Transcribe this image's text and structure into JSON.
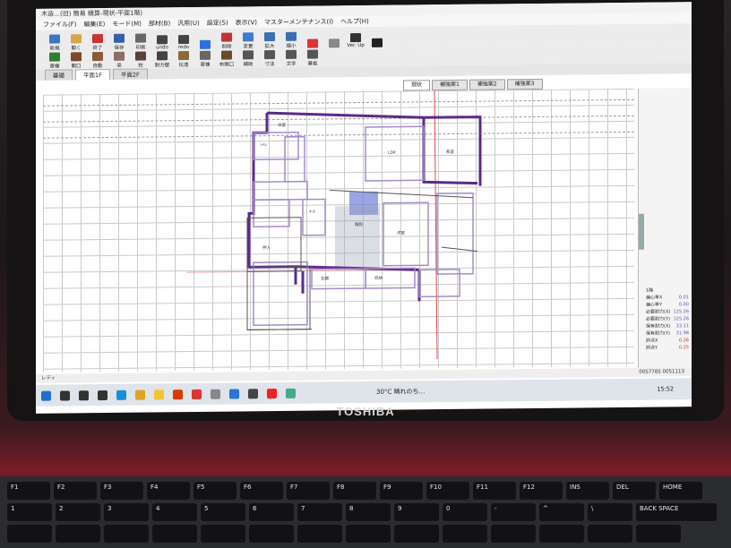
{
  "window": {
    "title": "木造…(旧)   簡易   積算-現状-平面1階)",
    "menu": [
      "ファイル(F)",
      "編集(E)",
      "モード(M)",
      "部材(B)",
      "汎用(U)",
      "設定(S)",
      "表示(V)",
      "マスターメンテナンス(I)",
      "ヘルプ(H)"
    ]
  },
  "toolbar1": [
    {
      "label": "新規",
      "icon": "new-file-icon",
      "color": "#3b78c4"
    },
    {
      "label": "開く",
      "icon": "open-folder-icon",
      "color": "#d7a54a"
    },
    {
      "label": "終了",
      "icon": "exit-icon",
      "color": "#c93535"
    },
    {
      "label": "保存",
      "icon": "save-icon",
      "color": "#3a5fa8"
    },
    {
      "label": "印刷",
      "icon": "print-icon",
      "color": "#666666"
    },
    {
      "label": "undo",
      "icon": "undo-icon",
      "color": "#444444"
    },
    {
      "label": "redo",
      "icon": "redo-icon",
      "color": "#444444"
    },
    {
      "label": "",
      "icon": "pointer-icon",
      "color": "#2f6fe0"
    },
    {
      "label": "削除",
      "icon": "delete-icon",
      "color": "#c33333"
    },
    {
      "label": "変更",
      "icon": "edit-icon",
      "color": "#3c7bd0"
    },
    {
      "label": "拡大",
      "icon": "zoom-in-icon",
      "color": "#3a6fb8"
    },
    {
      "label": "縮小",
      "icon": "zoom-out-icon",
      "color": "#3a6fb8"
    },
    {
      "label": "",
      "icon": "grid-icon",
      "color": "#d33"
    },
    {
      "label": "",
      "icon": "snap-grid-icon",
      "color": "#888888"
    },
    {
      "label": "Ver. Up",
      "icon": "version-up-icon",
      "color": "#333333"
    },
    {
      "label": "",
      "icon": "user-icon",
      "color": "#222222"
    }
  ],
  "toolbar2": [
    {
      "label": "寄棟",
      "color": "#2e7d32"
    },
    {
      "label": "開口",
      "color": "#7a4a2a"
    },
    {
      "label": "自動",
      "color": "#8a5a3a"
    },
    {
      "label": "梁",
      "color": "#8d6e63"
    },
    {
      "label": "柱",
      "color": "#5d4037"
    },
    {
      "label": "耐力壁",
      "color": "#444444"
    },
    {
      "label": "伝達",
      "color": "#8a6a3a"
    },
    {
      "label": "寄棟",
      "color": "#666666"
    },
    {
      "label": "布開口",
      "color": "#6a4a2a"
    },
    {
      "label": "補助",
      "color": "#555555"
    },
    {
      "label": "寸法",
      "color": "#555555"
    },
    {
      "label": "文字",
      "color": "#555555"
    },
    {
      "label": "基板",
      "color": "#555555"
    }
  ],
  "tabs": [
    "基礎",
    "平面1F",
    "平面2F"
  ],
  "active_tab": "平面1F",
  "subtabs": [
    "現状",
    "補強案1",
    "補強案2",
    "補強案3"
  ],
  "active_subtab": "現状",
  "room_labels": [
    "浴室",
    "ﾄｲﾚ",
    "LDK",
    "和室",
    "洋室",
    "階段",
    "玄関",
    "押入",
    "収納",
    "ﾎｰﾙ"
  ],
  "stats": [
    {
      "label": "1階",
      "value": ""
    },
    {
      "label": "偏心率X",
      "value": "0.01"
    },
    {
      "label": "偏心率Y",
      "value": "0.00"
    },
    {
      "label": "必要耐力(X)",
      "value": "125.26"
    },
    {
      "label": "必要耐力(Y)",
      "value": "125.26"
    },
    {
      "label": "保有耐力(X)",
      "value": "33.11"
    },
    {
      "label": "保有耐力(Y)",
      "value": "31.98"
    },
    {
      "label": "評点X",
      "value": "0.26"
    },
    {
      "label": "評点Y",
      "value": "0.25"
    }
  ],
  "status": {
    "mode": "レディ",
    "coords": "0057785   0051113"
  },
  "taskbar": {
    "weather": "30°C  晴れのち…",
    "time": "15:52",
    "icons": [
      "windows-start-icon",
      "search-icon",
      "cortana-icon",
      "task-view-icon",
      "edge-icon",
      "chrome-icon",
      "file-explorer-icon",
      "media-icon",
      "pin-icon",
      "app-icon",
      "photos-icon",
      "store-icon",
      "opera-icon",
      "app-icon"
    ]
  },
  "laptop": {
    "brand": "TOSHIBA"
  },
  "keyboard": {
    "row1": [
      "F1",
      "F2",
      "F3",
      "F4",
      "F5",
      "F6",
      "F7",
      "F8",
      "F9",
      "F10",
      "F11",
      "F12",
      "INS",
      "DEL",
      "HOME"
    ],
    "row2": [
      "1",
      "2",
      "3",
      "4",
      "5",
      "6",
      "7",
      "8",
      "9",
      "0",
      "-",
      "^",
      "\\",
      "BACK SPACE"
    ]
  },
  "colors": {
    "wall": "#5b2a8a",
    "wall_light": "#a58bc9",
    "red_line": "#e14848",
    "highlight": "#6f7fd8"
  }
}
